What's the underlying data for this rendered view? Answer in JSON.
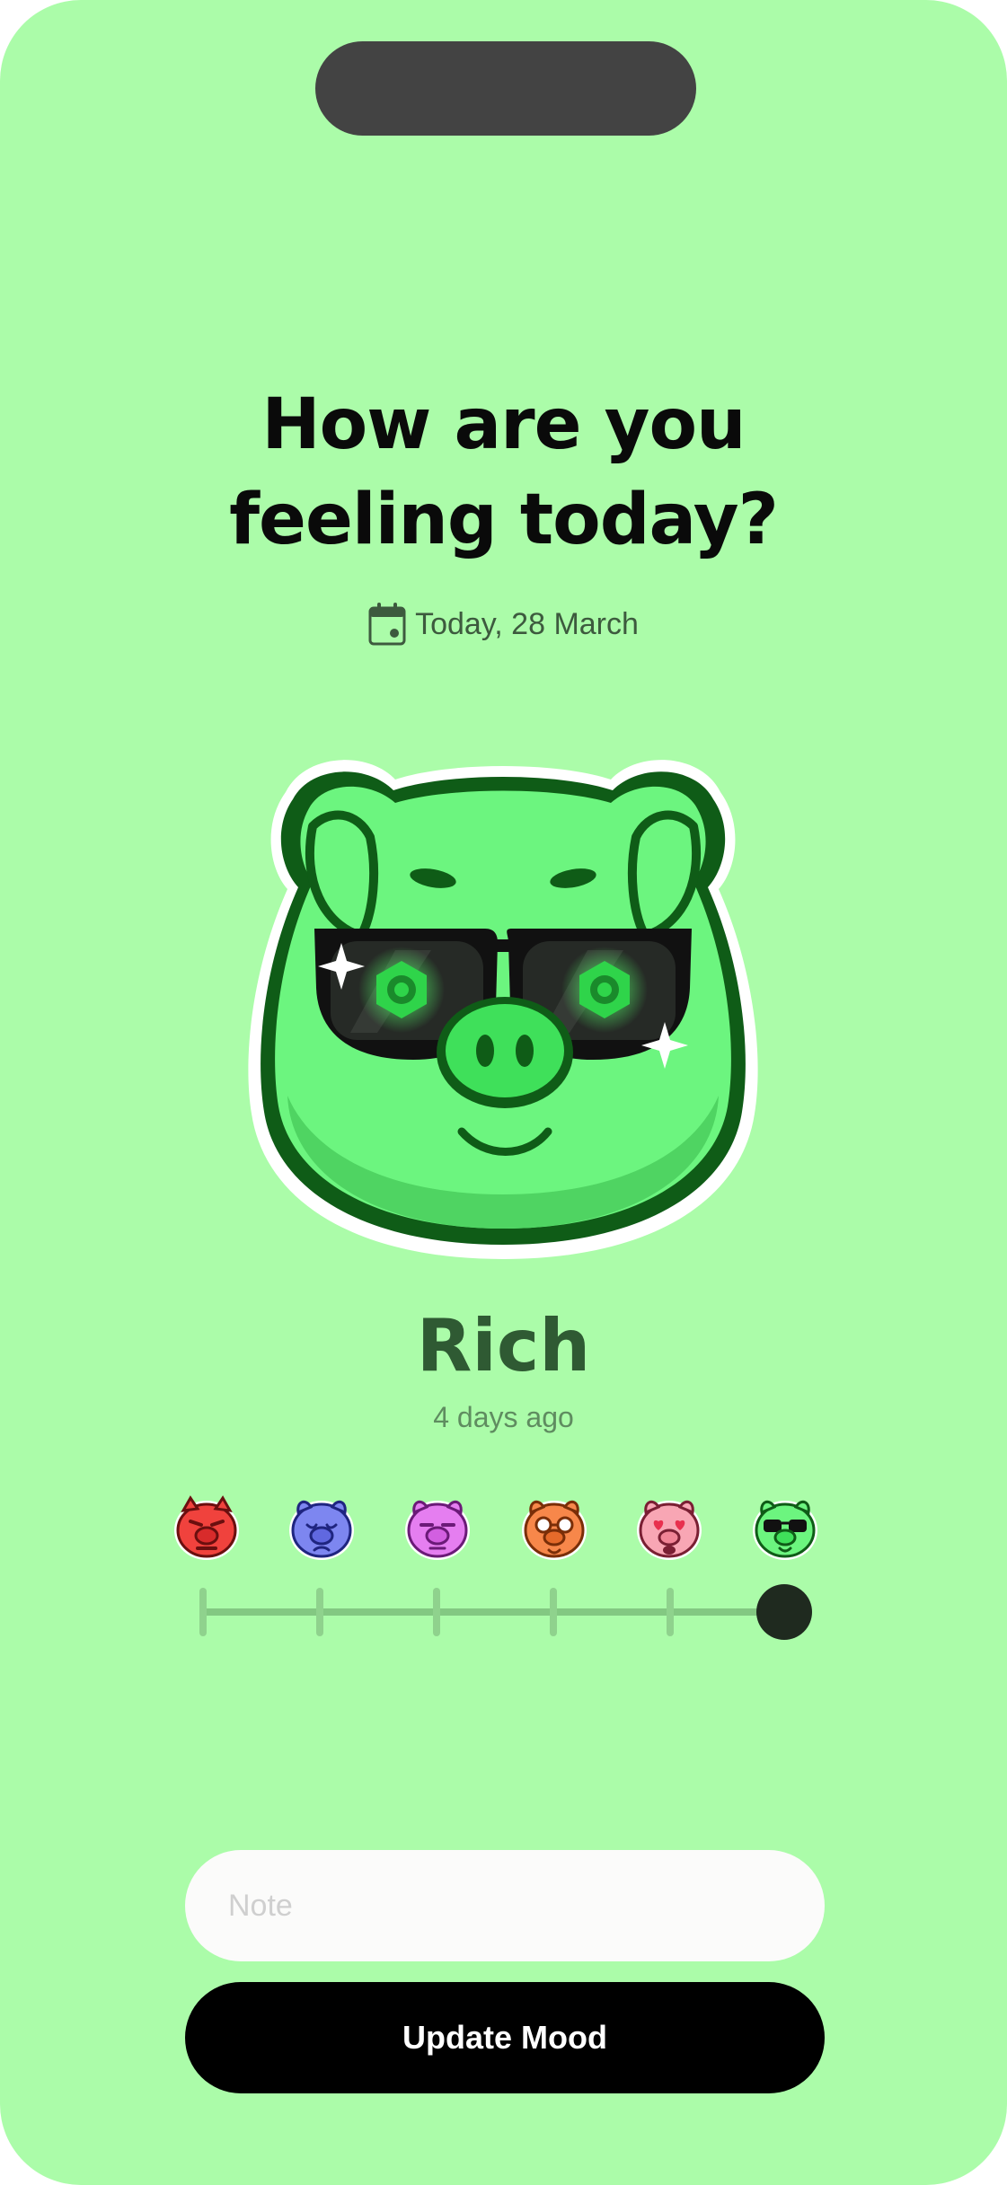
{
  "header": {
    "title_line1": "How are you",
    "title_line2": "feeling today?",
    "date_label": "Today, 28 March"
  },
  "current_mood": {
    "name": "Rich",
    "time_ago": "4 days ago",
    "icon": "green-pig-sunglasses-icon",
    "color": "#6cf57f"
  },
  "mood_options": [
    {
      "icon": "angry-red-pig-icon",
      "color": "#f0423d"
    },
    {
      "icon": "sad-blue-pig-icon",
      "color": "#7d86f0"
    },
    {
      "icon": "unimpressed-purple-pig-icon",
      "color": "#e57ef0"
    },
    {
      "icon": "nerdy-orange-pig-icon",
      "color": "#f7874a"
    },
    {
      "icon": "in-love-pink-pig-icon",
      "color": "#f8a6b4"
    },
    {
      "icon": "cool-green-pig-icon",
      "color": "#6cf57f"
    }
  ],
  "slider": {
    "steps": 6,
    "selected_index": 5
  },
  "note": {
    "placeholder": "Note",
    "value": ""
  },
  "actions": {
    "update_label": "Update Mood"
  },
  "colors": {
    "background": "#abfca9",
    "button": "#000000"
  }
}
